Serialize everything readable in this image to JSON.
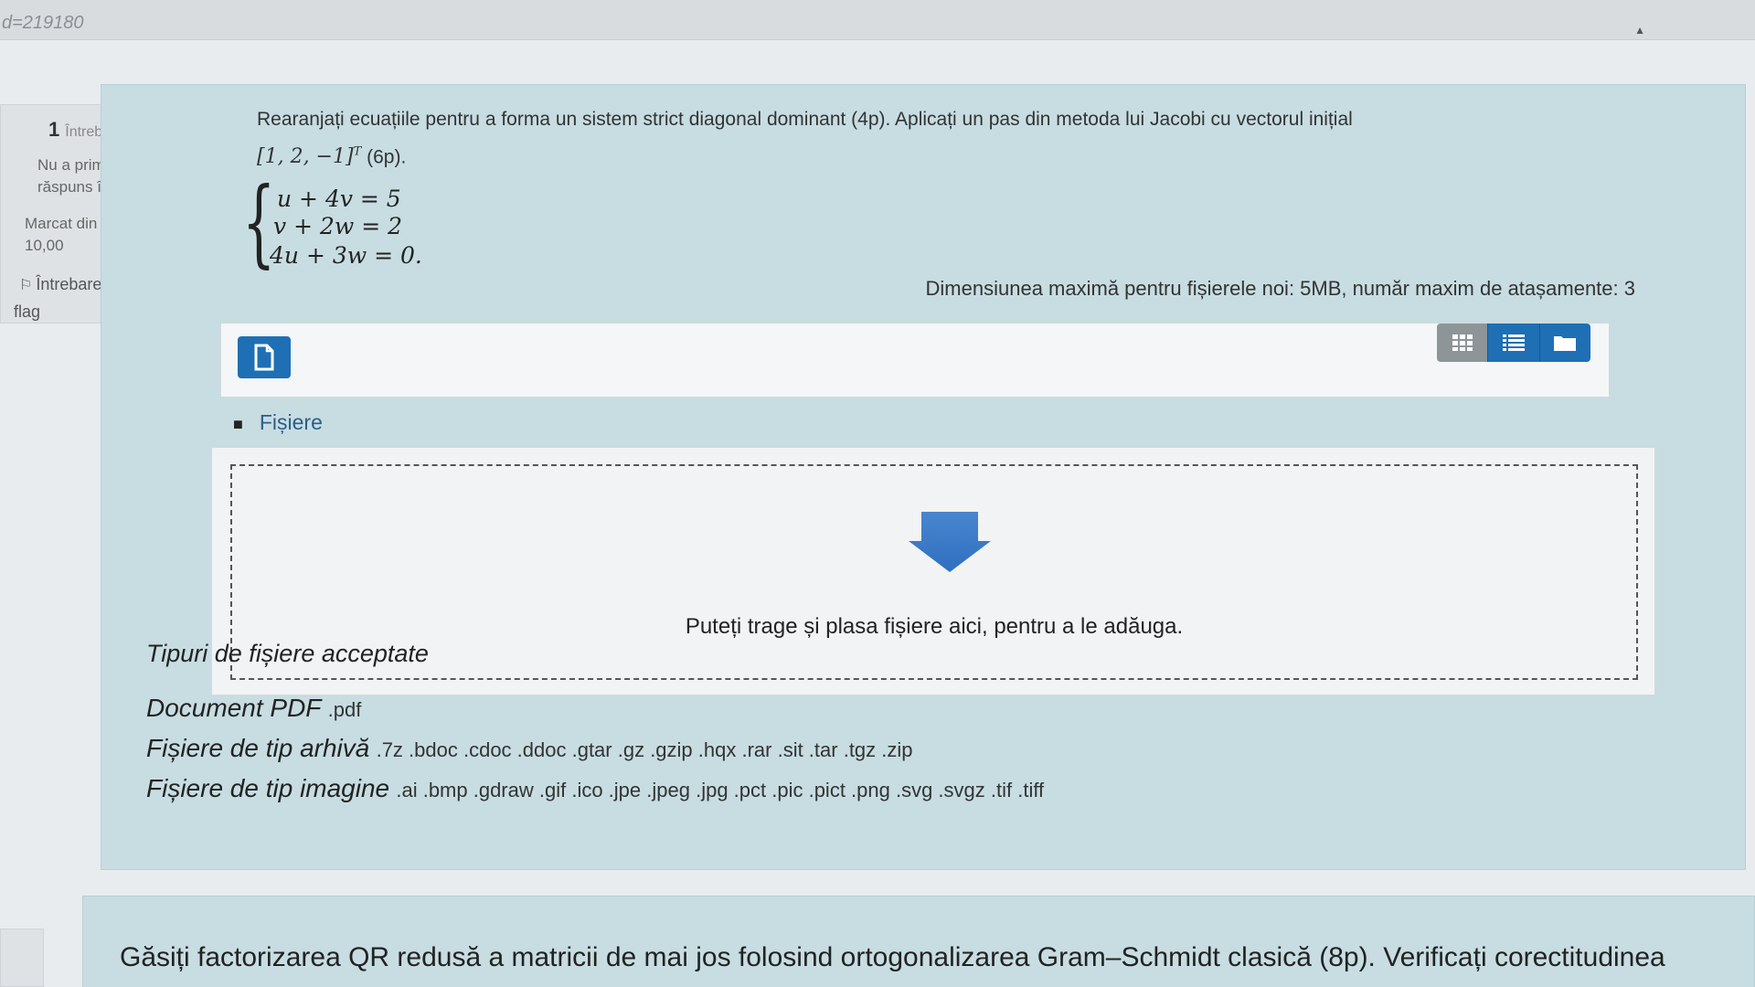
{
  "url_fragment": "d=219180",
  "question_info": {
    "number": "1",
    "label": "Întrebare",
    "state": [
      "Nu a primit",
      "răspuns încă"
    ],
    "grade": [
      "Marcat din",
      "10,00"
    ],
    "flag": [
      "Întrebare cu",
      "flag"
    ]
  },
  "question": {
    "text": "Rearanjați ecuațiile pentru a forma un sistem strict diagonal dominant (4p). Aplicați un pas din metoda lui Jacobi cu vectorul inițial",
    "vector": "[1, 2, −1]",
    "vector_sup": "T",
    "vector_points": "(6p).",
    "equations": [
      "u + 4v = 5",
      "v + 2w = 2",
      "4u + 3w = 0."
    ]
  },
  "filepicker": {
    "max_size_text": "Dimensiunea maximă pentru fișierele noi: 5MB, număr maxim de atașamente: 3",
    "path_label": "Fișiere",
    "drop_text": "Puteți trage și plasa fișiere aici, pentru a le adăuga."
  },
  "accepted_types": {
    "title": "Tipuri de fișiere acceptate",
    "rows": [
      {
        "label": "Document PDF",
        "ext": ".pdf"
      },
      {
        "label": "Fișiere de tip arhivă",
        "ext": ".7z .bdoc .cdoc .ddoc .gtar .gz .gzip .hqx .rar .sit .tar .tgz .zip"
      },
      {
        "label": "Fișiere de tip imagine",
        "ext": ".ai .bmp .gdraw .gif .ico .jpe .jpeg .jpg .pct .pic .pict .png .svg .svgz .tif .tiff"
      }
    ]
  },
  "next_question": {
    "text": "Găsiți factorizarea QR redusă a matricii de mai jos folosind ortogonalizarea Gram–Schmidt clasică (8p). Verificați corectitudinea"
  },
  "colors": {
    "accent": "#1f6fb5",
    "formulation_bg": "#c7dde2"
  },
  "icons": {
    "add_file": "file-icon",
    "view_grid": "grid-icon",
    "view_list": "list-icon",
    "view_tree": "folder-icon",
    "drop": "arrow-down-icon",
    "flag": "flag-icon"
  }
}
